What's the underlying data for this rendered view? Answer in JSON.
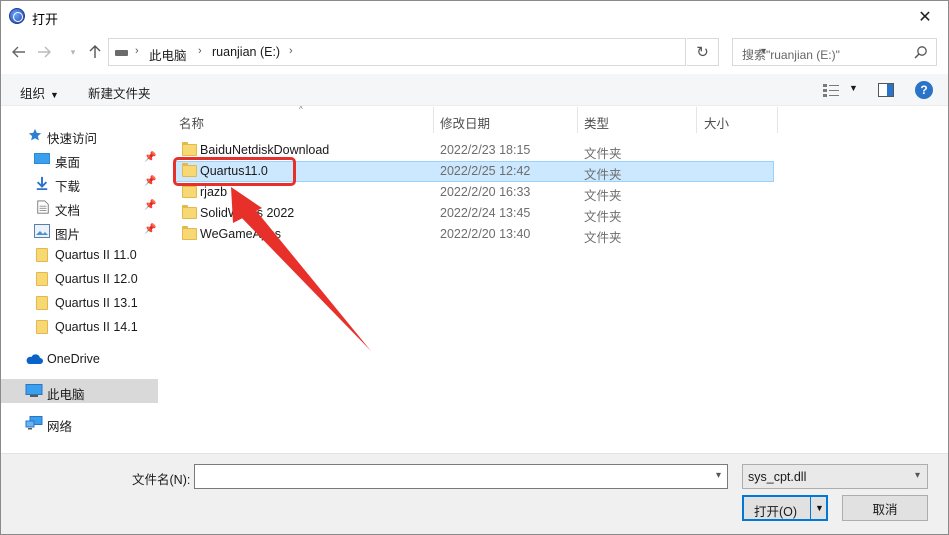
{
  "window": {
    "title": "打开"
  },
  "address": {
    "crumbs": [
      "此电脑",
      "ruanjian (E:)"
    ]
  },
  "search": {
    "placeholder": "搜索\"ruanjian (E:)\""
  },
  "toolbar": {
    "organize_label": "组织",
    "new_folder_label": "新建文件夹"
  },
  "sidebar": {
    "items": [
      {
        "label": "快速访问",
        "icon": "star-icon"
      },
      {
        "label": "桌面",
        "icon": "desktop-icon",
        "pinned": true
      },
      {
        "label": "下载",
        "icon": "download-icon",
        "pinned": true
      },
      {
        "label": "文档",
        "icon": "document-icon",
        "pinned": true
      },
      {
        "label": "图片",
        "icon": "picture-icon",
        "pinned": true
      },
      {
        "label": "Quartus II 11.0",
        "icon": "folder-icon"
      },
      {
        "label": "Quartus II 12.0",
        "icon": "folder-icon"
      },
      {
        "label": "Quartus II 13.1",
        "icon": "folder-icon"
      },
      {
        "label": "Quartus II 14.1",
        "icon": "folder-icon"
      },
      {
        "label": "OneDrive",
        "icon": "cloud-icon"
      },
      {
        "label": "此电脑",
        "icon": "computer-icon",
        "selected": true
      },
      {
        "label": "网络",
        "icon": "network-icon"
      }
    ]
  },
  "filelist": {
    "columns": [
      "名称",
      "修改日期",
      "类型",
      "大小"
    ],
    "rows": [
      {
        "name": "BaiduNetdiskDownload",
        "date": "2022/2/23 18:15",
        "type": "文件夹",
        "selected": false
      },
      {
        "name": "Quartus11.0",
        "date": "2022/2/25 12:42",
        "type": "文件夹",
        "selected": true
      },
      {
        "name": "rjazb",
        "date": "2022/2/20 16:33",
        "type": "文件夹",
        "selected": false
      },
      {
        "name": "SolidWorks 2022",
        "date": "2022/2/24 13:45",
        "type": "文件夹",
        "selected": false
      },
      {
        "name": "WeGameApps",
        "date": "2022/2/20 13:40",
        "type": "文件夹",
        "selected": false
      }
    ]
  },
  "bottom": {
    "filename_label": "文件名(N):",
    "filename_value": "",
    "filter_value": "sys_cpt.dll",
    "open_label": "打开(O)",
    "cancel_label": "取消"
  },
  "colors": {
    "selection": "#cce8ff",
    "annotation": "#e8302a",
    "accent": "#0078d7"
  }
}
